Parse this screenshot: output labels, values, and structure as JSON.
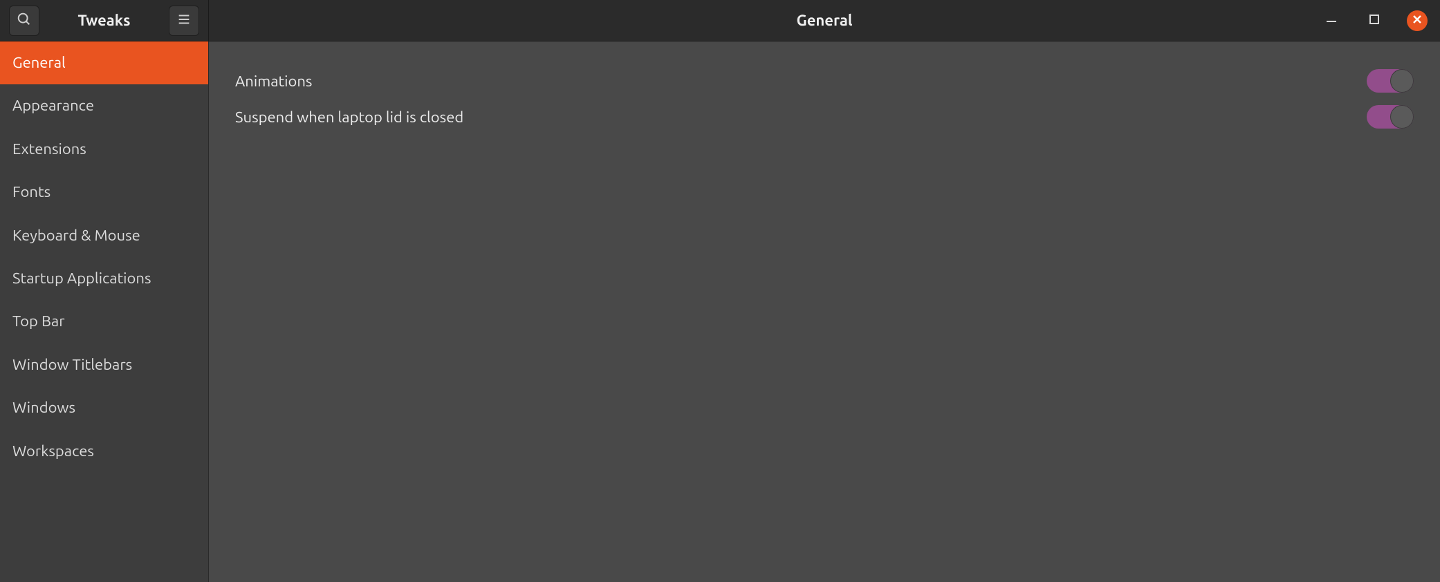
{
  "app_title": "Tweaks",
  "page_title": "General",
  "sidebar": {
    "items": [
      {
        "label": "General",
        "name": "sidebar-item-general",
        "active": true
      },
      {
        "label": "Appearance",
        "name": "sidebar-item-appearance",
        "active": false
      },
      {
        "label": "Extensions",
        "name": "sidebar-item-extensions",
        "active": false
      },
      {
        "label": "Fonts",
        "name": "sidebar-item-fonts",
        "active": false
      },
      {
        "label": "Keyboard & Mouse",
        "name": "sidebar-item-keyboard-mouse",
        "active": false
      },
      {
        "label": "Startup Applications",
        "name": "sidebar-item-startup-applications",
        "active": false
      },
      {
        "label": "Top Bar",
        "name": "sidebar-item-top-bar",
        "active": false
      },
      {
        "label": "Window Titlebars",
        "name": "sidebar-item-window-titlebars",
        "active": false
      },
      {
        "label": "Windows",
        "name": "sidebar-item-windows",
        "active": false
      },
      {
        "label": "Workspaces",
        "name": "sidebar-item-workspaces",
        "active": false
      }
    ]
  },
  "settings": [
    {
      "label": "Animations",
      "name": "setting-animations",
      "on": true
    },
    {
      "label": "Suspend when laptop lid is closed",
      "name": "setting-suspend-lid",
      "on": true
    }
  ],
  "colors": {
    "accent": "#e95420",
    "toggle_on": "#924d8b"
  }
}
